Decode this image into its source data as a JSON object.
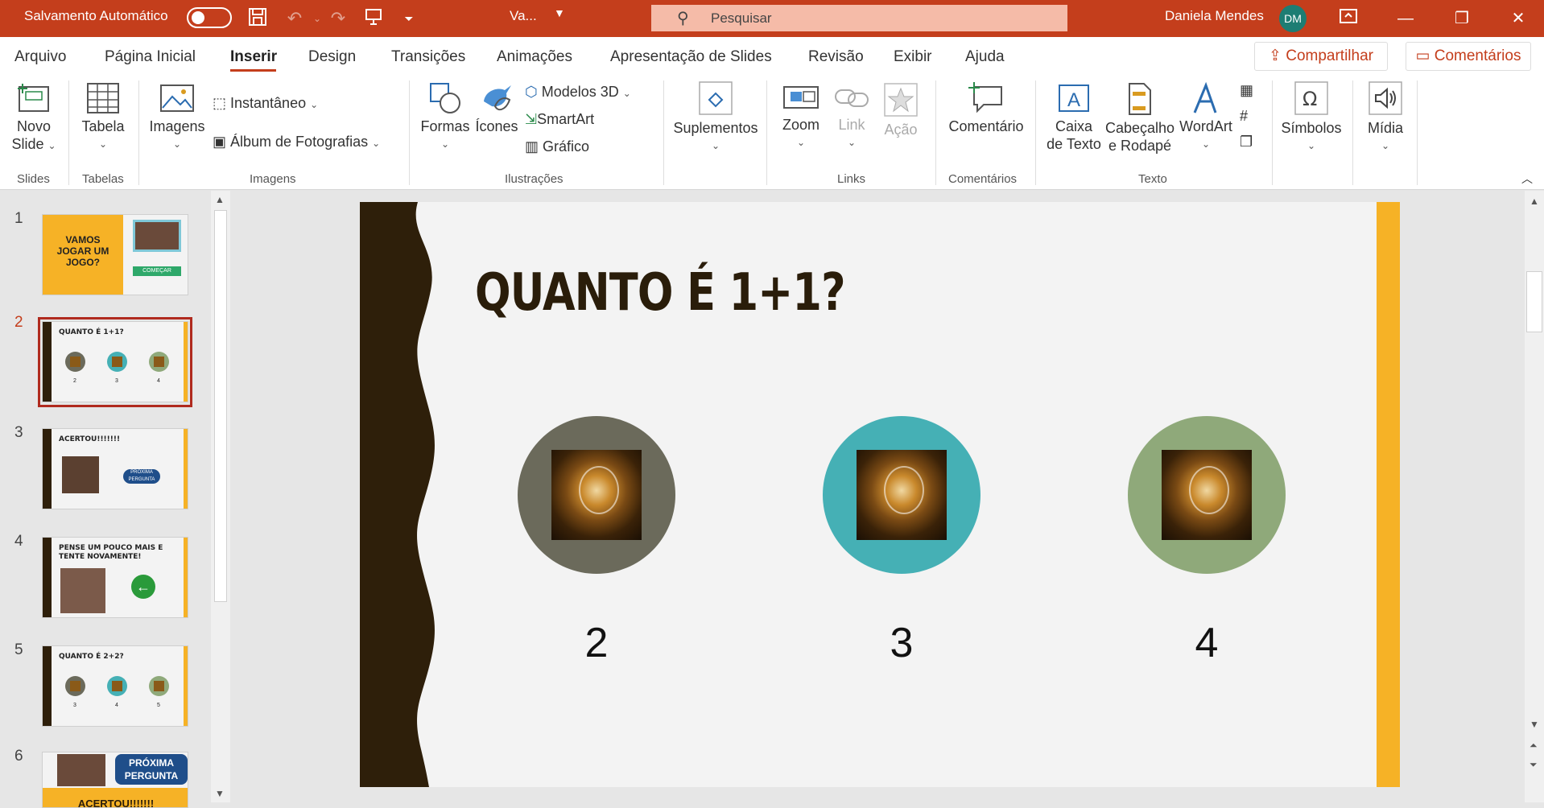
{
  "titlebar": {
    "autosave_label": "Salvamento Automático",
    "filename": "Va...",
    "search_placeholder": "Pesquisar",
    "user_name": "Daniela Mendes",
    "user_initials": "DM",
    "colors": {
      "bar": "#c43e1c",
      "avatar": "#1d7d73"
    }
  },
  "menu": {
    "items": [
      "Arquivo",
      "Página Inicial",
      "Inserir",
      "Design",
      "Transições",
      "Animações",
      "Apresentação de Slides",
      "Revisão",
      "Exibir",
      "Ajuda"
    ],
    "active": "Inserir",
    "share_label": "Compartilhar",
    "comments_label": "Comentários"
  },
  "ribbon": {
    "groups": {
      "slides": "Slides",
      "tables": "Tabelas",
      "images": "Imagens",
      "illustrations": "Ilustrações",
      "links": "Links",
      "comments": "Comentários",
      "text": "Texto"
    },
    "buttons": {
      "new_slide_1": "Novo",
      "new_slide_2": "Slide",
      "table": "Tabela",
      "images": "Imagens",
      "screenshot": "Instantâneo",
      "photo_album": "Álbum de Fotografias",
      "shapes": "Formas",
      "icons": "Ícones",
      "models3d": "Modelos 3D",
      "smartart": "SmartArt",
      "chart": "Gráfico",
      "addins": "Suplementos",
      "zoom": "Zoom",
      "link": "Link",
      "action": "Ação",
      "comment": "Comentário",
      "textbox_1": "Caixa",
      "textbox_2": "de Texto",
      "header_1": "Cabeçalho",
      "header_2": "e Rodapé",
      "wordart": "WordArt",
      "symbols": "Símbolos",
      "media": "Mídia"
    }
  },
  "thumbnails": [
    {
      "num": "1",
      "title": "VAMOS JOGAR UM JOGO?",
      "button": "COMEÇAR"
    },
    {
      "num": "2",
      "title": "QUANTO É 1+1?",
      "labels": [
        "2",
        "3",
        "4"
      ]
    },
    {
      "num": "3",
      "title": "ACERTOU!!!!!!!",
      "button": "PRÓXIMA PERGUNTA"
    },
    {
      "num": "4",
      "title": "PENSE UM POUCO MAIS E TENTE NOVAMENTE!"
    },
    {
      "num": "5",
      "title": "QUANTO É 2+2?",
      "labels": [
        "3",
        "4",
        "5"
      ]
    },
    {
      "num": "6",
      "title": "ACERTOU!!!!!!!",
      "button": "PRÓXIMA PERGUNTA"
    }
  ],
  "selected_slide": "2",
  "slide": {
    "title": "QUANTO É 1+1?",
    "options": [
      {
        "label": "2",
        "color": "#6b6a5b"
      },
      {
        "label": "3",
        "color": "#45b0b5"
      },
      {
        "label": "4",
        "color": "#8fa97a"
      }
    ],
    "accent": "#f6b226",
    "left_band": "#2e1f0a"
  }
}
